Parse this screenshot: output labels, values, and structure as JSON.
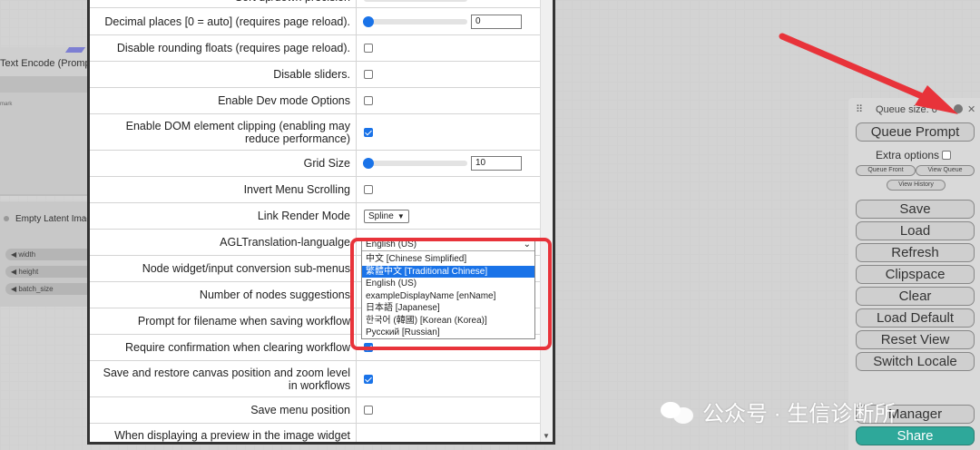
{
  "nodes": {
    "text_encode": {
      "title": "Text Encode (Prompt)",
      "body_hint": "mark"
    },
    "empty_latent": {
      "title": "Empty Latent Image",
      "inputs": [
        "width",
        "height",
        "batch_size"
      ]
    }
  },
  "settings": {
    "rows": [
      {
        "label": "Sort up/down precision",
        "type": "partial"
      },
      {
        "label": "Decimal places [0 = auto] (requires page reload).",
        "type": "slider",
        "value": "0"
      },
      {
        "label": "Disable rounding floats (requires page reload).",
        "type": "checkbox",
        "checked": false
      },
      {
        "label": "Disable sliders.",
        "type": "checkbox",
        "checked": false
      },
      {
        "label": "Enable Dev mode Options",
        "type": "checkbox",
        "checked": false
      },
      {
        "label": "Enable DOM element clipping (enabling may reduce performance)",
        "type": "checkbox",
        "checked": true
      },
      {
        "label": "Grid Size",
        "type": "slider",
        "value": "10"
      },
      {
        "label": "Invert Menu Scrolling",
        "type": "checkbox",
        "checked": false
      },
      {
        "label": "Link Render Mode",
        "type": "select",
        "value": "Spline"
      },
      {
        "label": "AGLTranslation-langualge",
        "type": "select-open",
        "value": "English (US)"
      },
      {
        "label": "Node widget/input conversion sub-menus",
        "type": "hidden"
      },
      {
        "label": "Number of nodes suggestions",
        "type": "hidden"
      },
      {
        "label": "Prompt for filename when saving workflow",
        "type": "hidden"
      },
      {
        "label": "Require confirmation when clearing workflow",
        "type": "checkbox",
        "checked": true
      },
      {
        "label": "Save and restore canvas position and zoom level in workflows",
        "type": "checkbox",
        "checked": true
      },
      {
        "label": "Save menu position",
        "type": "checkbox",
        "checked": false
      },
      {
        "label": "When displaying a preview in the image widget",
        "type": "partial"
      }
    ]
  },
  "language_dropdown": {
    "selected": "English (US)",
    "options": [
      "中文 [Chinese Simplified]",
      "繁體中文 [Traditional Chinese]",
      "English (US)",
      "exampleDisplayName [enName]",
      "日本語 [Japanese]",
      "한국어 (韓國) [Korean (Korea)]",
      "Русский [Russian]"
    ],
    "highlighted_index": 1
  },
  "queue_panel": {
    "title": "Queue size: 0",
    "queue_prompt": "Queue Prompt",
    "extra_options": "Extra options",
    "queue_front": "Queue Front",
    "view_queue": "View Queue",
    "view_history": "View History",
    "buttons": [
      "Save",
      "Load",
      "Refresh",
      "Clipspace",
      "Clear",
      "Load Default",
      "Reset View",
      "Switch Locale"
    ],
    "partial_button": "Manager",
    "share": "Share"
  },
  "watermark": "公众号 · 生信诊断所",
  "colors": {
    "accent": "#1a73e8",
    "highlight_box": "#e8333a",
    "share": "#2ea89a"
  }
}
